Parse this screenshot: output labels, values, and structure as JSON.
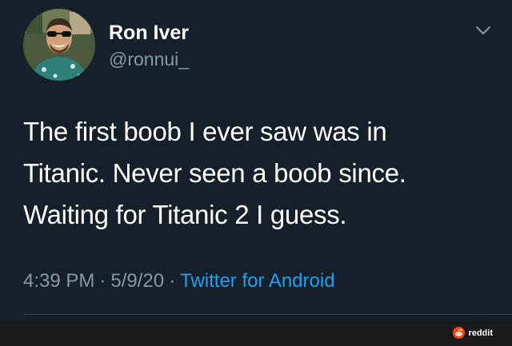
{
  "author": {
    "display_name": "Ron Iver",
    "handle": "@ronnui_"
  },
  "tweet": {
    "text_lines": [
      "The first boob I ever saw was in",
      "Titanic. Never seen a boob since.",
      "Waiting for Titanic 2 I guess."
    ],
    "time": "4:39 PM",
    "date": "5/9/20",
    "separator": "·",
    "source": "Twitter for Android"
  },
  "watermark": {
    "label": "reddit"
  },
  "colors": {
    "background": "#15202b",
    "secondary_text": "#8899a6",
    "link": "#1da1f2",
    "reddit_orange": "#ff4500"
  },
  "icons": {
    "menu": "chevron-down-icon",
    "watermark": "reddit-alien-icon"
  }
}
